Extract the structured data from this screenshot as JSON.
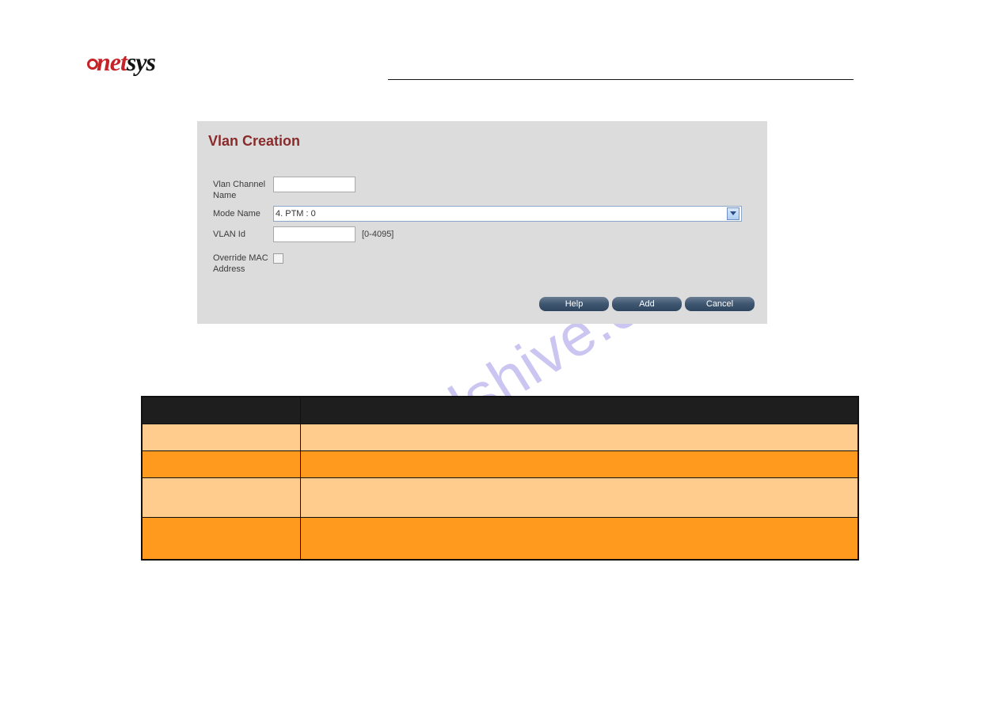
{
  "logo": {
    "part1": "net",
    "part2": "sys"
  },
  "watermark": "manualshive.com",
  "panel": {
    "title": "Vlan Creation",
    "vlan_channel_name": {
      "label": "Vlan Channel Name",
      "value": ""
    },
    "mode_name": {
      "label": "Mode Name",
      "value": "4. PTM : 0"
    },
    "vlan_id": {
      "label": "VLAN Id",
      "value": "",
      "hint": "[0-4095]"
    },
    "override_mac": {
      "label": "Override MAC Address",
      "checked": false
    }
  },
  "buttons": {
    "help": "Help",
    "add": "Add",
    "cancel": "Cancel"
  },
  "table": {
    "header": {
      "col1": "",
      "col2": ""
    },
    "rows": [
      {
        "c1": "",
        "c2": "",
        "shade": "light",
        "h": "normal"
      },
      {
        "c1": "",
        "c2": "",
        "shade": "dark",
        "h": "normal"
      },
      {
        "c1": "",
        "c2": "",
        "shade": "light",
        "h": "tall"
      },
      {
        "c1": "",
        "c2": "",
        "shade": "dark",
        "h": "tall2"
      }
    ]
  }
}
